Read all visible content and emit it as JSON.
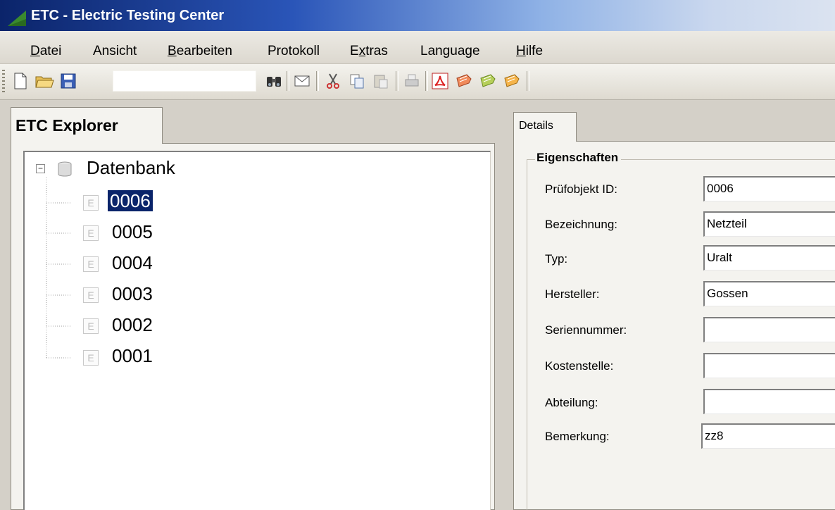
{
  "window": {
    "title": "ETC - Electric Testing Center"
  },
  "menu": {
    "items": [
      {
        "id": "datei",
        "prefix": "",
        "accel": "D",
        "rest": "atei"
      },
      {
        "id": "ansicht",
        "prefix": "",
        "accel": "",
        "rest": "Ansicht"
      },
      {
        "id": "bearbeiten",
        "prefix": "",
        "accel": "B",
        "rest": "earbeiten"
      },
      {
        "id": "protokoll",
        "prefix": "",
        "accel": "",
        "rest": "Protokoll"
      },
      {
        "id": "extras",
        "prefix": "E",
        "accel": "x",
        "rest": "tras"
      },
      {
        "id": "language",
        "prefix": "",
        "accel": "",
        "rest": "Language"
      },
      {
        "id": "hilfe",
        "prefix": "",
        "accel": "H",
        "rest": "ilfe"
      }
    ]
  },
  "toolbar": {
    "search_value": "",
    "icons": [
      "new-file-icon",
      "open-folder-icon",
      "save-icon",
      "binoculars-icon",
      "mail-icon",
      "cut-icon",
      "copy-icon",
      "paste-icon",
      "print-icon",
      "pdf-icon",
      "label-red-icon",
      "label-green-icon",
      "label-orange-icon"
    ]
  },
  "explorer": {
    "tab_label": "ETC Explorer",
    "root_label": "Datenbank",
    "item_icon_letter": "E",
    "items": [
      "0006",
      "0005",
      "0004",
      "0003",
      "0002",
      "0001"
    ],
    "selected": "0006"
  },
  "details": {
    "tab_label": "Details",
    "group_title": "Eigenschaften",
    "fields": [
      {
        "label": "Prüfobjekt ID:",
        "value": "0006"
      },
      {
        "label": "Bezeichnung:",
        "value": "Netzteil"
      },
      {
        "label": "Typ:",
        "value": "Uralt"
      },
      {
        "label": "Hersteller:",
        "value": "Gossen"
      },
      {
        "label": "Seriennummer:",
        "value": ""
      },
      {
        "label": "Kostenstelle:",
        "value": ""
      },
      {
        "label": "Abteilung:",
        "value": ""
      },
      {
        "label": "Bemerkung:",
        "value": "zz8"
      }
    ]
  },
  "colors": {
    "selection": "#0a246a",
    "titlebar": "#0b246a"
  }
}
